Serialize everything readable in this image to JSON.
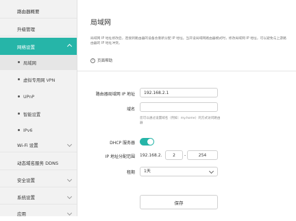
{
  "sidebar": {
    "items": [
      {
        "label": "路由器概要"
      },
      {
        "label": "升级管理"
      },
      {
        "label": "网络设置"
      },
      {
        "label": "局域网"
      },
      {
        "label": "虚拟专用网 VPN"
      },
      {
        "label": "UPnP"
      },
      {
        "label": "智能设置"
      },
      {
        "label": "IPv6"
      },
      {
        "label": "Wi-Fi 设置"
      },
      {
        "label": "动态域名服务 DDNS"
      },
      {
        "label": "安全设置"
      },
      {
        "label": "系统设置"
      },
      {
        "label": "应用"
      }
    ],
    "active_color": "#26b5a8"
  },
  "main": {
    "title": "局域网",
    "description": "局域网 IP 地址修改后，连接到路由器的设备会重新分配 IP 地址。当开设局域网路由器模式时，修改局域网 IP 地址，可以避免与上游路由器的 IP 地址冲突。",
    "help_label": "页面帮助",
    "form": {
      "ip_label": "路由器局域网 IP 地址",
      "ip_value": "192.168.2.1",
      "domain_label": "域名",
      "domain_value": "",
      "domain_hint": "您可以通过设置域名（例如：my.home）的方式访问路由器",
      "dhcp_label": "DHCP 服务器",
      "dhcp_enabled": true,
      "range_label": "IP 地址分配范围",
      "range_prefix": "192.168.2.",
      "range_start": "2",
      "range_dash": "-",
      "range_end": "254",
      "lease_label": "租期",
      "lease_value": "1天"
    },
    "save_label": "保存"
  }
}
